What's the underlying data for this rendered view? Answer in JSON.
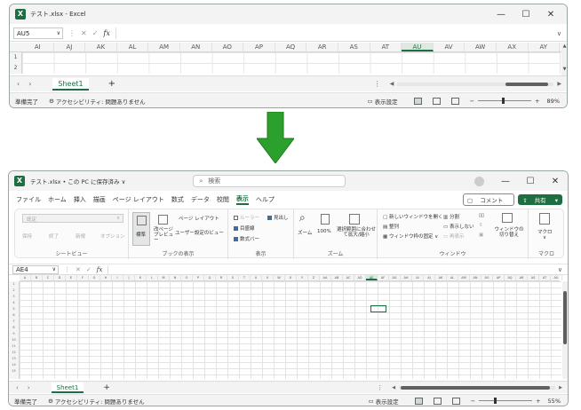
{
  "top_window": {
    "title": "テスト.xlsx - Excel",
    "controls": [
      "—",
      "☐",
      "✕"
    ],
    "namebox": "AU5",
    "columns": [
      "AI",
      "AJ",
      "AK",
      "AL",
      "AM",
      "AN",
      "AO",
      "AP",
      "AQ",
      "AR",
      "AS",
      "AT",
      "AU",
      "AV",
      "AW",
      "AX",
      "AY"
    ],
    "selected_column": "AU",
    "rows": [
      "1",
      "2"
    ],
    "sheet_tab": "Sheet1",
    "add_sheet": "+",
    "status_ready": "準備完了",
    "accessibility": "アクセシビリティ: 問題ありません",
    "display_settings": "表示設定",
    "zoom": "89%"
  },
  "bottom_window": {
    "title": "テスト.xlsx • この PC に保存済み ∨",
    "search_placeholder": "検索",
    "menu": [
      "ファイル",
      "ホーム",
      "挿入",
      "描画",
      "ページ レイアウト",
      "数式",
      "データ",
      "校閲",
      "表示",
      "ヘルプ"
    ],
    "active_menu": "表示",
    "comment_button": "コメント",
    "share_button": "共有",
    "ribbon": {
      "sheetview_label": "シートビュー",
      "sheetview_dropdown": "既定",
      "sheetview_items": [
        "保持",
        "終了",
        "新規",
        "オプション"
      ],
      "book_label": "ブックの表示",
      "book_normal": "標準",
      "book_pagebreak": "改ページプレビュー",
      "book_pagelayout": "ページ レイアウト",
      "book_custom": "ユーザー設定のビュー",
      "display_label": "表示",
      "display_ruler": "ルーラー",
      "display_gridlines": "目盛線",
      "display_formulabar": "数式バー",
      "display_headings": "見出し",
      "zoom_label": "ズーム",
      "zoom_zoom": "ズーム",
      "zoom_100": "100%",
      "zoom_selection": "選択範囲に合わせて拡大/縮小",
      "window_label": "ウィンドウ",
      "window_new": "新しいウィンドウを開く",
      "window_arrange": "整列",
      "window_freeze": "ウィンドウ枠の固定",
      "window_split": "分割",
      "window_hide": "表示しない",
      "window_unhide": "再表示",
      "window_switch": "ウィンドウの切り替え",
      "macro_label": "マクロ",
      "macro_button": "マクロ"
    },
    "namebox": "AE4",
    "columns": [
      "A",
      "B",
      "C",
      "D",
      "E",
      "F",
      "G",
      "H",
      "I",
      "J",
      "K",
      "L",
      "M",
      "N",
      "O",
      "P",
      "Q",
      "R",
      "S",
      "T",
      "U",
      "V",
      "W",
      "X",
      "Y",
      "Z",
      "AA",
      "AB",
      "AC",
      "AD",
      "AE",
      "AF",
      "AG",
      "AH",
      "AI",
      "AJ",
      "AK",
      "AL",
      "AM",
      "AN",
      "AO",
      "AP",
      "AQ",
      "AR",
      "AS",
      "AT",
      "AU"
    ],
    "selected_column": "AE",
    "rows": [
      "1",
      "2",
      "3",
      "4",
      "5",
      "6",
      "7",
      "8",
      "9",
      "10",
      "11",
      "12",
      "13",
      "14",
      "15"
    ],
    "sheet_tab": "Sheet1",
    "add_sheet": "+",
    "status_ready": "準備完了",
    "accessibility": "アクセシビリティ: 問題ありません",
    "display_settings": "表示設定",
    "zoom": "55%"
  },
  "colors": {
    "excel_green": "#1d6f42",
    "arrow_green": "#2ca02c"
  }
}
